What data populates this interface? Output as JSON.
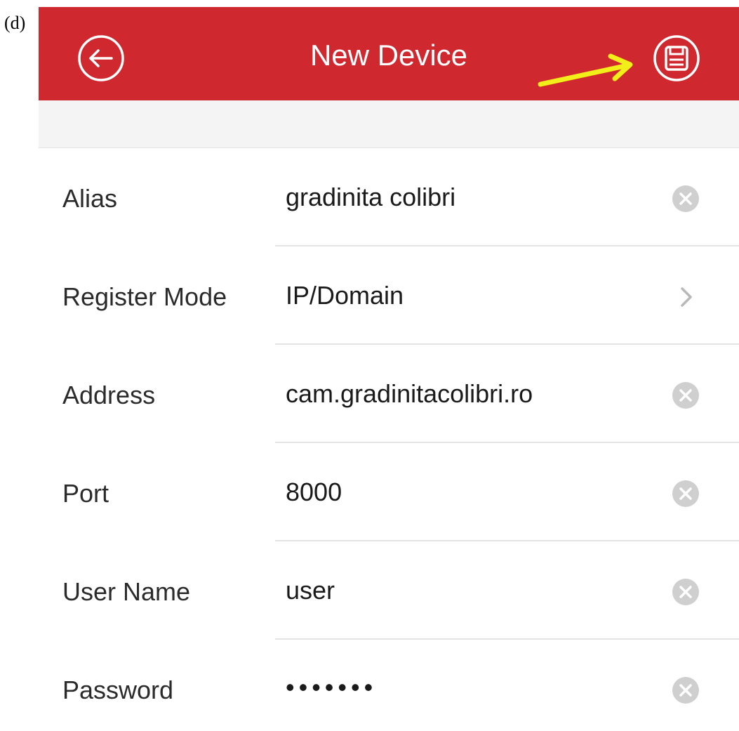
{
  "figure_label": "(d)",
  "header": {
    "title": "New Device",
    "background": "#d0282f",
    "back_icon": "back-arrow-circle-icon",
    "save_icon": "save-floppy-circle-icon"
  },
  "annotation": {
    "arrow_color": "#f2ee1a"
  },
  "form": {
    "rows": [
      {
        "label": "Alias",
        "value": "gradinita colibri",
        "action": "clear-icon"
      },
      {
        "label": "Register Mode",
        "value": "IP/Domain",
        "action": "chevron-right-icon"
      },
      {
        "label": "Address",
        "value": "cam.gradinitacolibri.ro",
        "action": "clear-icon"
      },
      {
        "label": "Port",
        "value": "8000",
        "action": "clear-icon"
      },
      {
        "label": "User Name",
        "value": "user",
        "action": "clear-icon"
      },
      {
        "label": "Password",
        "value": "•••••••",
        "action": "clear-icon"
      }
    ]
  }
}
